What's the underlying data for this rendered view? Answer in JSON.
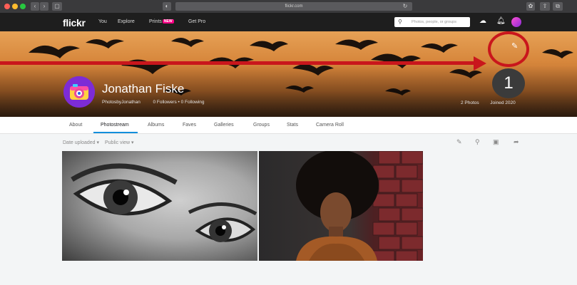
{
  "browser": {
    "url": "flickr.com"
  },
  "nav": {
    "logo": "flickr",
    "links": [
      "You",
      "Explore",
      "Prints",
      "Get Pro"
    ],
    "new_badge": "NEW",
    "search_placeholder": "Photos, people, or groups"
  },
  "profile": {
    "name": "Jonathan Fiske",
    "username": "PhotosbyJonathan",
    "followers": "0 Followers",
    "following": "0 Following",
    "separator": "•",
    "photos_count": "2 Photos",
    "joined": "Joined 2020"
  },
  "tabs": [
    "About",
    "Photostream",
    "Albums",
    "Faves",
    "Galleries",
    "Groups",
    "Stats",
    "Camera Roll"
  ],
  "active_tab": "Photostream",
  "filters": {
    "sort": "Date uploaded ▾",
    "view": "Public view ▾"
  },
  "annotation": {
    "step_number": "1"
  },
  "colors": {
    "nav_bg": "#1e1e1e",
    "accent_blue": "#128fdc",
    "annotation_red": "#c9161c",
    "new_badge": "#ff0084"
  },
  "icons": [
    "search-icon",
    "upload-icon",
    "bell-icon",
    "pencil-icon",
    "magnifier-icon",
    "slideshow-icon",
    "share-icon"
  ]
}
